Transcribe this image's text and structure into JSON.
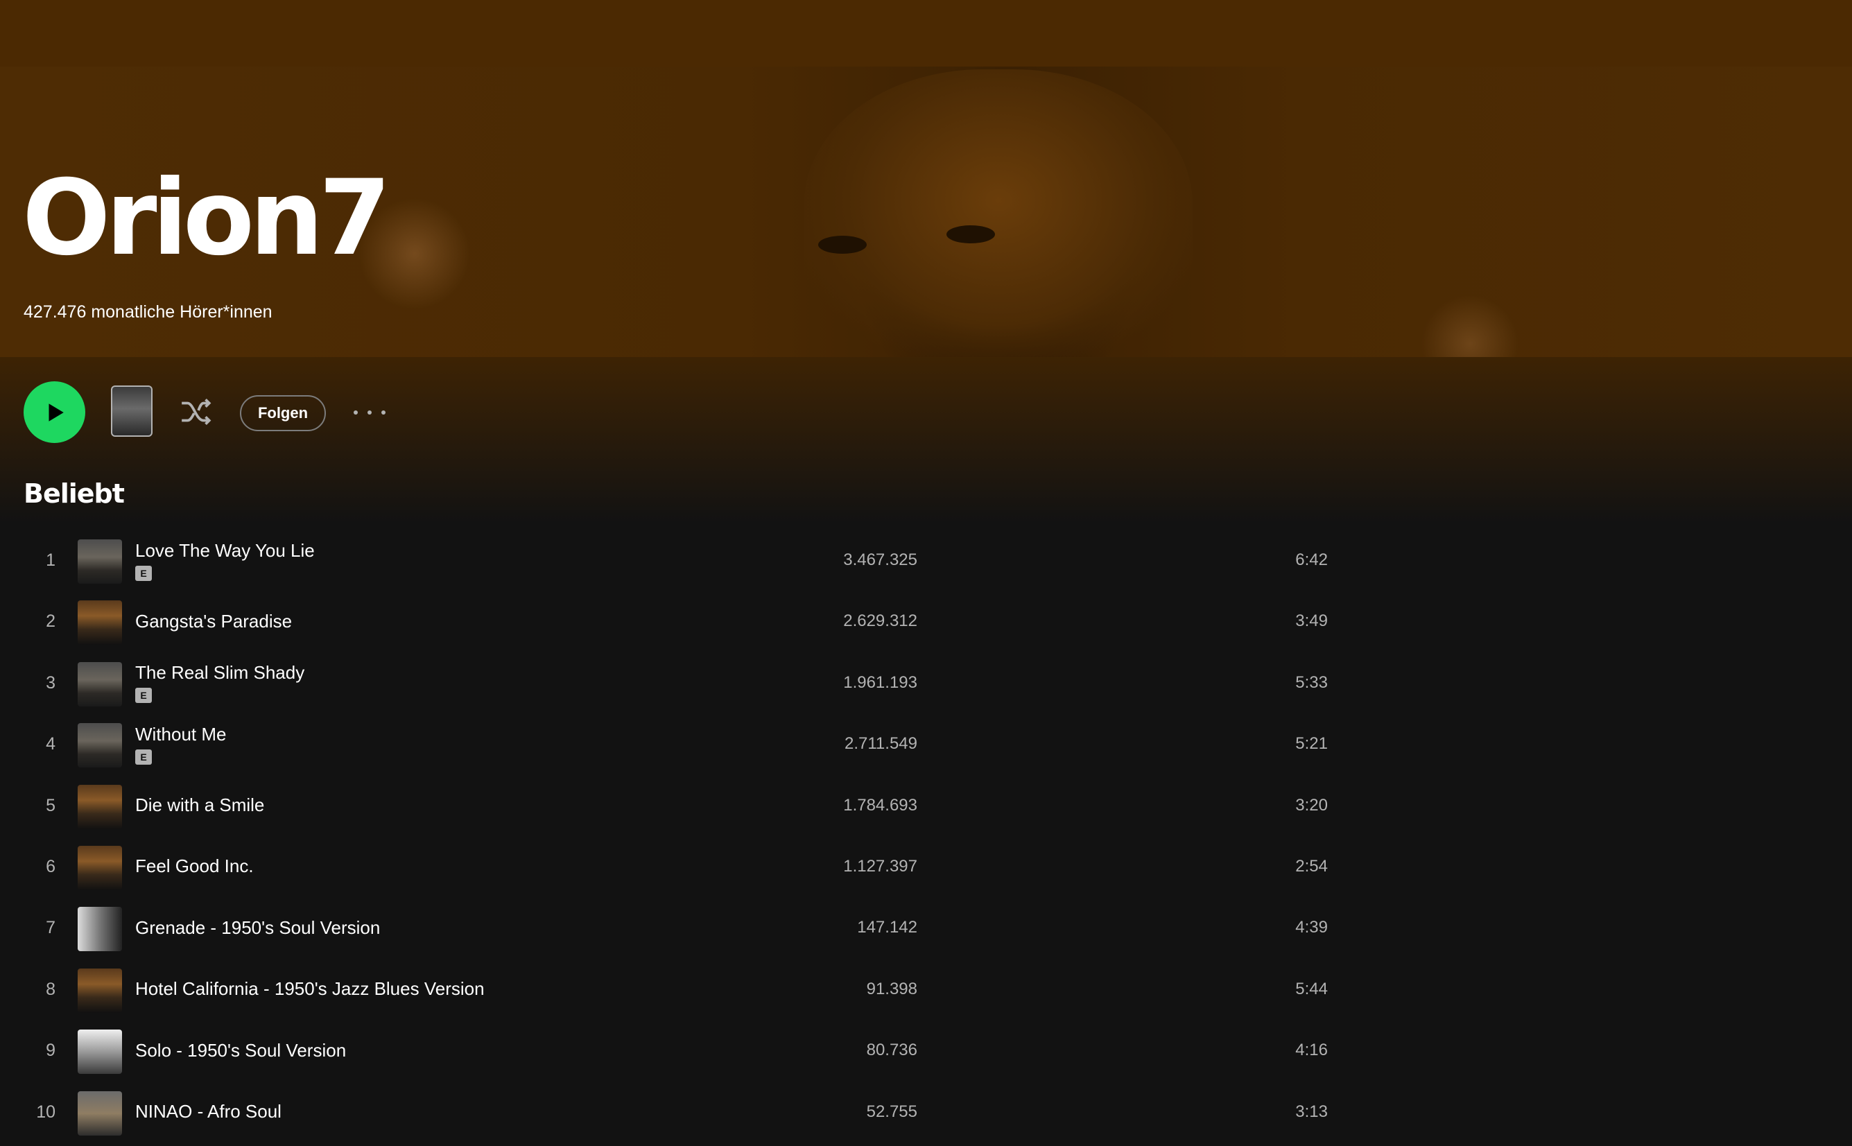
{
  "artist": {
    "name": "Orion7",
    "monthly_listeners": "427.476 monatliche Hörer*innen"
  },
  "actions": {
    "follow_label": "Folgen",
    "play_icon": "play-icon",
    "shuffle_icon": "shuffle-icon",
    "more_icon": "more-options-icon"
  },
  "colors": {
    "accent": "#1ed760",
    "hero_background": "#4a2a03",
    "page_background": "#121212"
  },
  "popular": {
    "title": "Beliebt",
    "explicit_label": "E",
    "tracks": [
      {
        "num": "1",
        "title": "Love The Way You Lie",
        "plays": "3.467.325",
        "duration": "6:42",
        "explicit": true,
        "art": "city"
      },
      {
        "num": "2",
        "title": "Gangsta's Paradise",
        "plays": "2.629.312",
        "duration": "3:49",
        "explicit": false,
        "art": "sunset"
      },
      {
        "num": "3",
        "title": "The Real Slim Shady",
        "plays": "1.961.193",
        "duration": "5:33",
        "explicit": true,
        "art": "city"
      },
      {
        "num": "4",
        "title": "Without Me",
        "plays": "2.711.549",
        "duration": "5:21",
        "explicit": true,
        "art": "city"
      },
      {
        "num": "5",
        "title": "Die with a Smile",
        "plays": "1.784.693",
        "duration": "3:20",
        "explicit": false,
        "art": "sunset"
      },
      {
        "num": "6",
        "title": "Feel Good Inc.",
        "plays": "1.127.397",
        "duration": "2:54",
        "explicit": false,
        "art": "sunset"
      },
      {
        "num": "7",
        "title": "Grenade - 1950's Soul Version",
        "plays": "147.142",
        "duration": "4:39",
        "explicit": false,
        "art": "bw"
      },
      {
        "num": "8",
        "title": "Hotel California - 1950's Jazz Blues Version",
        "plays": "91.398",
        "duration": "5:44",
        "explicit": false,
        "art": "sunset"
      },
      {
        "num": "9",
        "title": "Solo - 1950's Soul Version",
        "plays": "80.736",
        "duration": "4:16",
        "explicit": false,
        "art": "street"
      },
      {
        "num": "10",
        "title": "NINAO - Afro Soul",
        "plays": "52.755",
        "duration": "3:13",
        "explicit": false,
        "art": "ninao"
      }
    ]
  }
}
